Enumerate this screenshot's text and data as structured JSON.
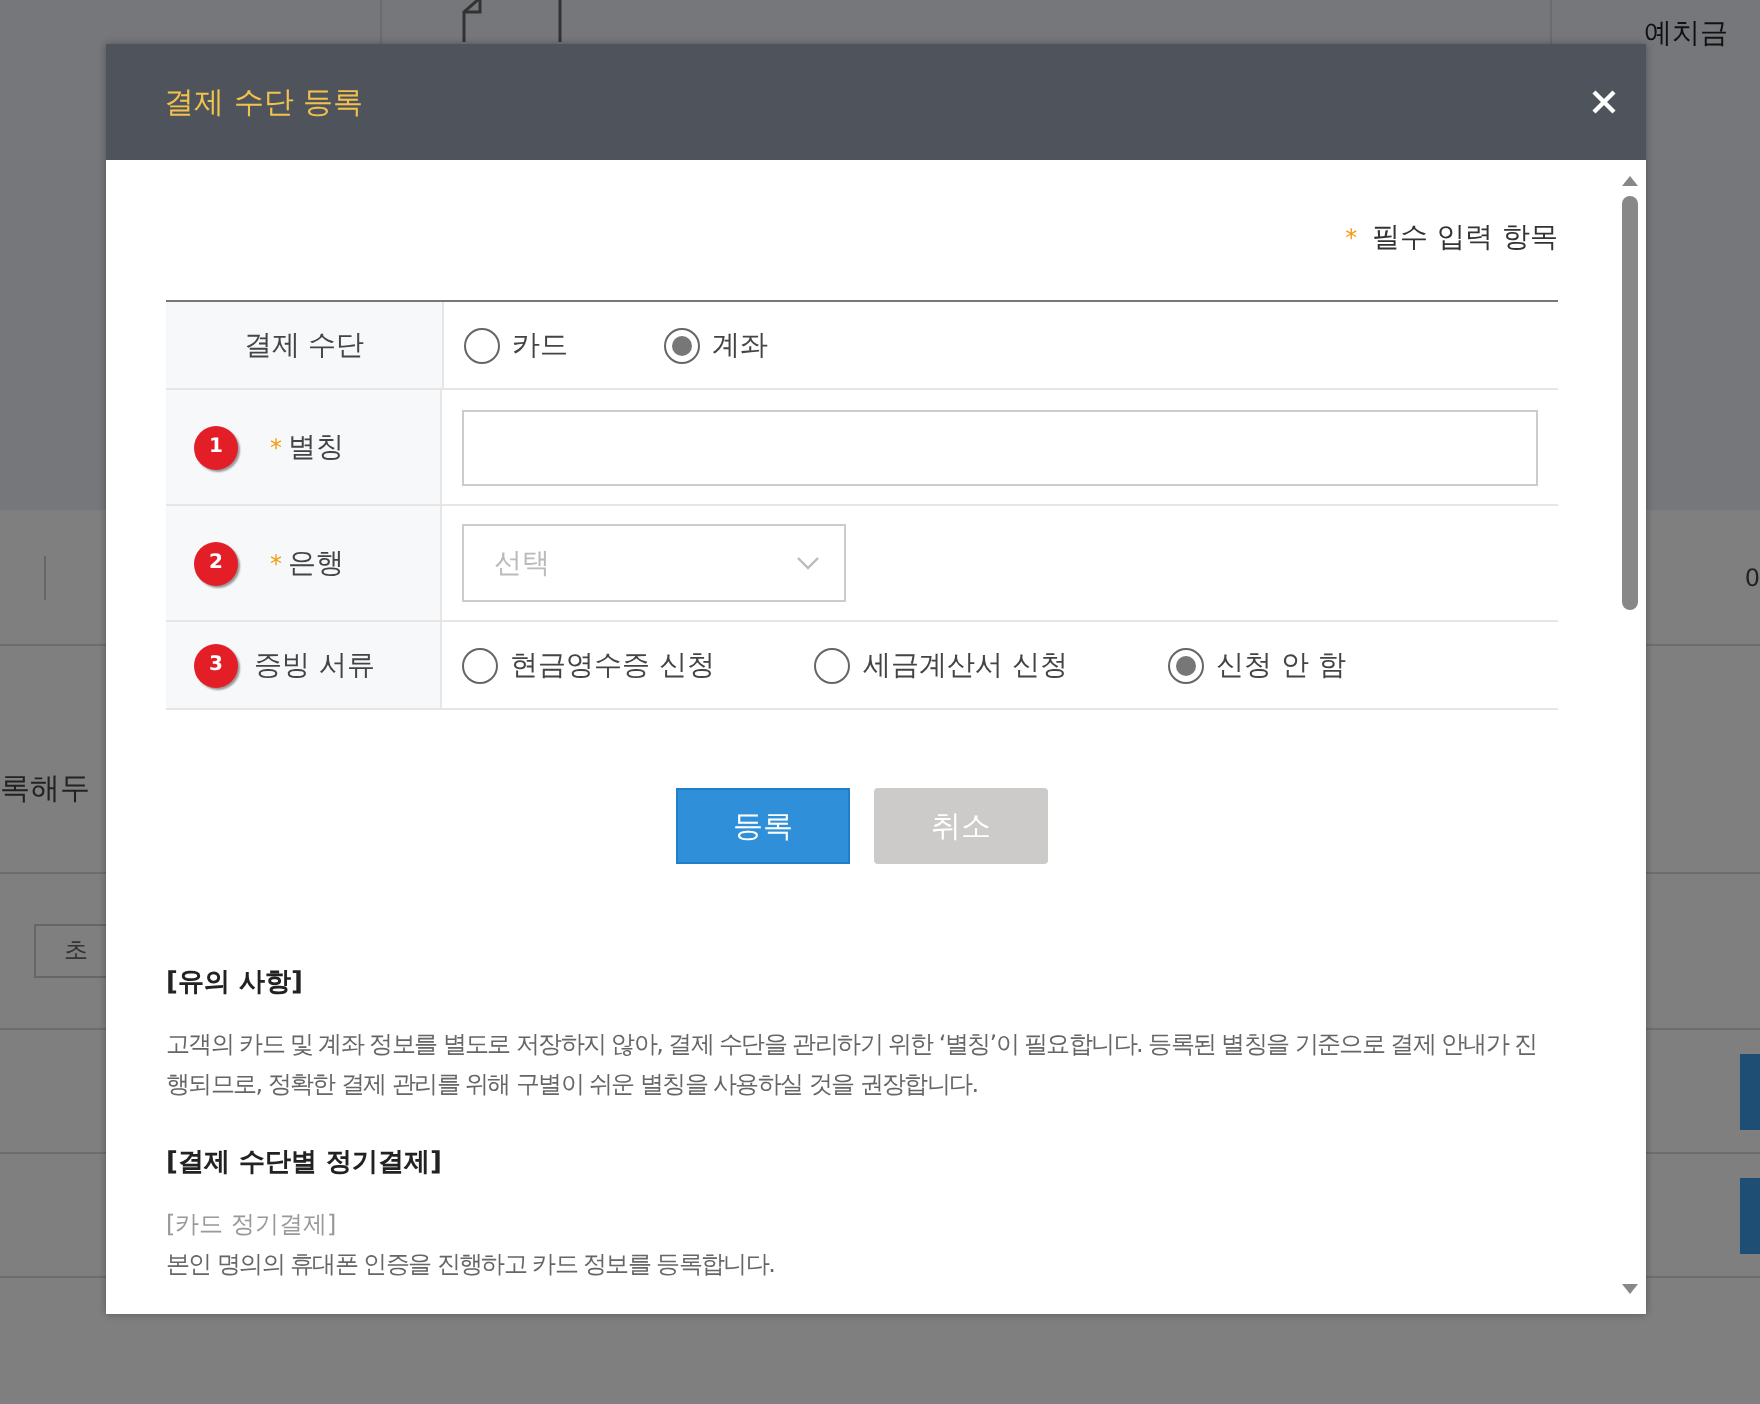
{
  "background": {
    "top_right_label": "예치금",
    "heading_fragment": "록해두",
    "button_fragment": "초",
    "cell_fragment": "0"
  },
  "modal": {
    "title": "결제 수단 등록",
    "required_note": {
      "mark": "*",
      "text": "필수 입력 항목"
    },
    "fields": [
      {
        "kind": "radio",
        "label": "결제 수단",
        "options": [
          {
            "label": "카드",
            "selected": false
          },
          {
            "label": "계좌",
            "selected": true
          }
        ]
      },
      {
        "kind": "text",
        "badge": "1",
        "mark": "*",
        "label": "별칭"
      },
      {
        "kind": "select",
        "badge": "2",
        "mark": "*",
        "label": "은행",
        "placeholder": "선택"
      },
      {
        "kind": "radio",
        "badge": "3",
        "label": "증빙 서류",
        "options": [
          {
            "label": "현금영수증 신청",
            "selected": false
          },
          {
            "label": "세금계산서 신청",
            "selected": false
          },
          {
            "label": "신청 안 함",
            "selected": true
          }
        ]
      }
    ],
    "buttons": [
      {
        "label": "등록",
        "kind": "primary"
      },
      {
        "label": "취소",
        "kind": "secondary"
      }
    ],
    "notes": [
      {
        "heading": "[유의 사항]",
        "paragraphs": [
          {
            "kind": "body",
            "text": "고객의 카드 및 계좌 정보를 별도로 저장하지 않아, 결제 수단을 관리하기 위한 ‘별칭’이 필요합니다. 등록된 별칭을 기준으로 결제 안내가 진행되므로, 정확한 결제 관리를 위해 구별이 쉬운 별칭을 사용하실 것을 권장합니다."
          }
        ]
      },
      {
        "heading": "[결제 수단별 정기결제]",
        "paragraphs": [
          {
            "kind": "subheading",
            "text": "[카드 정기결제]"
          },
          {
            "kind": "body",
            "text": "본인 명의의 휴대폰 인증을 진행하고 카드 정보를 등록합니다."
          }
        ]
      }
    ]
  }
}
